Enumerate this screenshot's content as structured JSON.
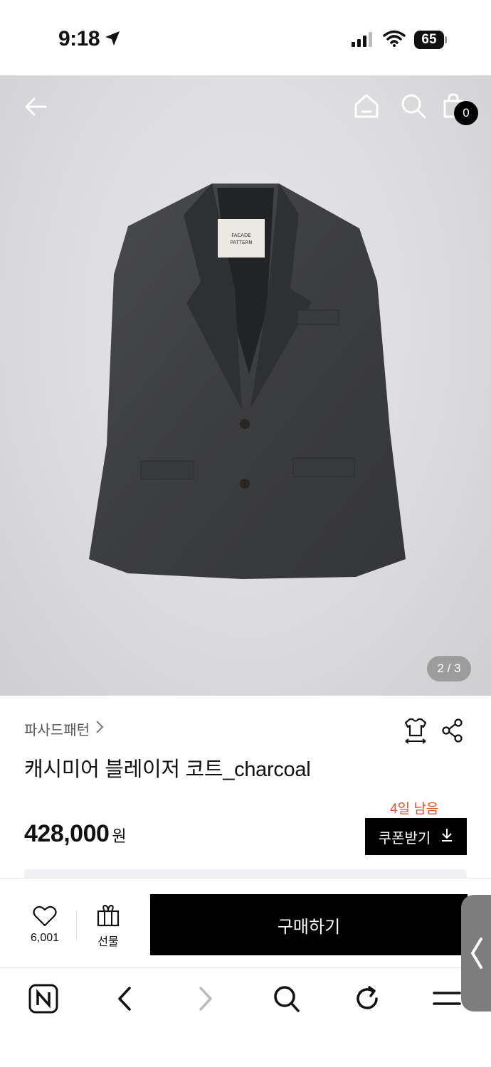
{
  "status_bar": {
    "time": "9:18",
    "battery": "65"
  },
  "top_nav": {
    "cart_count": "0"
  },
  "gallery": {
    "counter": "2 / 3",
    "label_text": "FACADE PATTERN"
  },
  "product": {
    "brand": "파사드패턴",
    "title": "캐시미어 블레이저 코트_charcoal",
    "price": "428,000",
    "price_unit": "원"
  },
  "coupon": {
    "days_left": "4일 남음",
    "button_label": "쿠폰받기"
  },
  "action_bar": {
    "like_count": "6,001",
    "gift_label": "선물",
    "buy_label": "구매하기"
  },
  "colors": {
    "accent_orange": "#e0532a",
    "primary_black": "#000000"
  }
}
